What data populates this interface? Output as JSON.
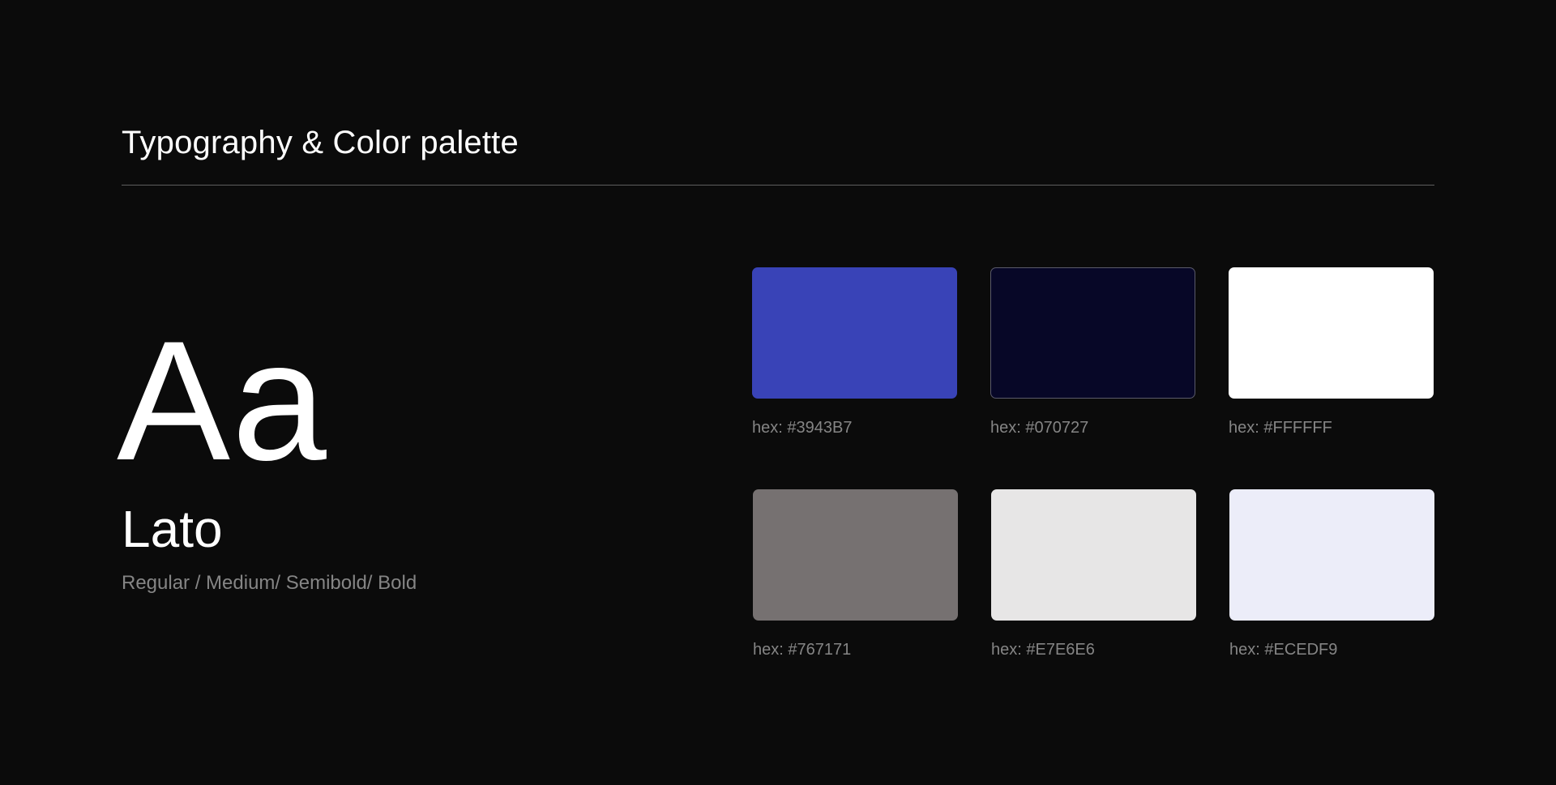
{
  "header": {
    "title": "Typography & Color palette"
  },
  "typography": {
    "specimen": "Aa",
    "font_name": "Lato",
    "weights": "Regular / Medium/ Semibold/ Bold"
  },
  "palette": {
    "swatches": [
      {
        "hex": "#3943B7",
        "label": "hex: #3943B7"
      },
      {
        "hex": "#070727",
        "label": "hex: #070727"
      },
      {
        "hex": "#FFFFFF",
        "label": "hex: #FFFFFF"
      },
      {
        "hex": "#767171",
        "label": "hex: #767171"
      },
      {
        "hex": "#E7E6E6",
        "label": "hex: #E7E6E6"
      },
      {
        "hex": "#ECEDF9",
        "label": "hex: #ECEDF9"
      }
    ]
  },
  "colors": {
    "background": "#0b0b0b",
    "text_primary": "#ffffff",
    "text_muted": "#858585",
    "divider": "#5e5e5e"
  }
}
